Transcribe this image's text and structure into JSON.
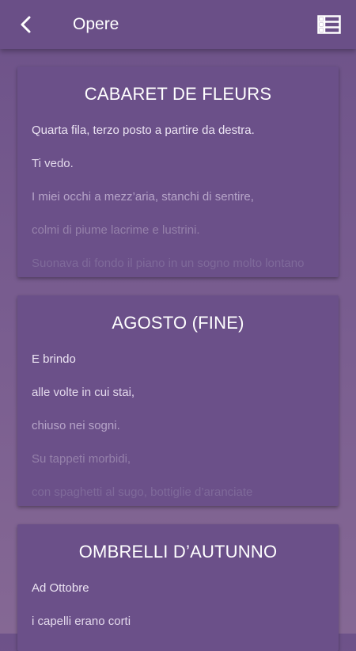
{
  "appbar": {
    "title": "Opere",
    "back_icon": "chevron-left-icon",
    "list_icon": "list-view-icon"
  },
  "colors": {
    "appbar": "#6a4f87",
    "card": "#6b5089",
    "background": "#7a5e90",
    "text": "#ffffff"
  },
  "cards": [
    {
      "title": "CABARET DE FLEURS",
      "lines": [
        "Quarta fila, terzo posto a partire da destra.",
        "Ti vedo.",
        "I miei occhi a mezz’aria, stanchi di sentire,",
        "colmi di piume lacrime e lustrini.",
        "Suonava di fondo il piano in un sogno molto lontano"
      ]
    },
    {
      "title": "AGOSTO (FINE)",
      "lines": [
        "E brindo",
        "alle volte in cui stai,",
        "chiuso nei sogni.",
        "Su tappeti morbidi,",
        "con spaghetti al sugo, bottiglie d’aranciate"
      ]
    },
    {
      "title": "OMBRELLI D’AUTUNNO",
      "lines": [
        "Ad Ottobre",
        "i capelli erano corti"
      ]
    }
  ]
}
